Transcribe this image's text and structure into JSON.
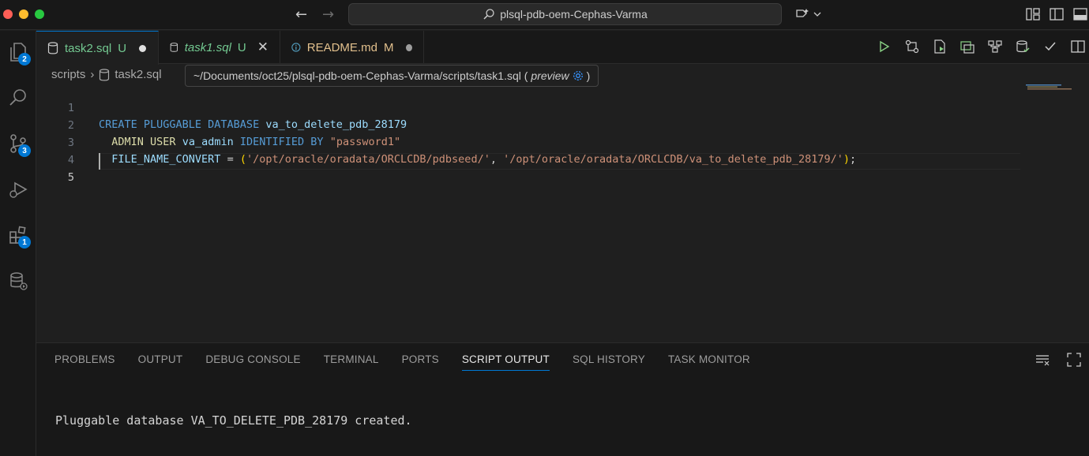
{
  "window": {
    "title": "plsql-pdb-oem-Cephas-Varma"
  },
  "nav": {
    "back": "←",
    "forward": "→"
  },
  "activity": {
    "explorer_badge": "2",
    "scm_badge": "3",
    "extensions_badge": "1"
  },
  "tabs": [
    {
      "label": "task2.sql",
      "status": "U",
      "color": "#73c991",
      "modified_dot": "#e0e0e0"
    },
    {
      "label": "task1.sql",
      "status": "U",
      "color": "#73c991"
    },
    {
      "label": "README.md",
      "status": "M",
      "color": "#e2c08d",
      "modified_dot": "#9d9d9d"
    }
  ],
  "breadcrumb": {
    "folder": "scripts",
    "file": "task2.sql"
  },
  "tooltip": {
    "path": "~/Documents/oct25/plsql-pdb-oem-Cephas-Varma/scripts/task1.sql (",
    "preview": "preview",
    "close": ")"
  },
  "editor": {
    "line_numbers": [
      "1",
      "2",
      "3",
      "4",
      "5"
    ],
    "lines": [
      {
        "kw1": "CREATE PLUGGABLE DATABASE",
        "name": "va_to_delete_pdb_28179"
      },
      {
        "kw_admin": "ADMIN",
        "kw_user": "USER",
        "user": "va_admin",
        "kw_ident": "IDENTIFIED BY",
        "password": "\"password1\""
      },
      {
        "kw_fnc": "FILE_NAME_CONVERT",
        "eq": " = ",
        "open": "(",
        "src": "'/opt/oracle/oradata/ORCLCDB/pdbseed/'",
        "comma": ", ",
        "dst": "'/opt/oracle/oradata/ORCLCDB/va_to_delete_pdb_28179/'",
        "close": ")",
        "semi": ";"
      }
    ]
  },
  "panel": {
    "tabs": [
      "PROBLEMS",
      "OUTPUT",
      "DEBUG CONSOLE",
      "TERMINAL",
      "PORTS",
      "SCRIPT OUTPUT",
      "SQL HISTORY",
      "TASK MONITOR"
    ],
    "active_tab": "SCRIPT OUTPUT",
    "output": "Pluggable database VA_TO_DELETE_PDB_28179 created."
  }
}
